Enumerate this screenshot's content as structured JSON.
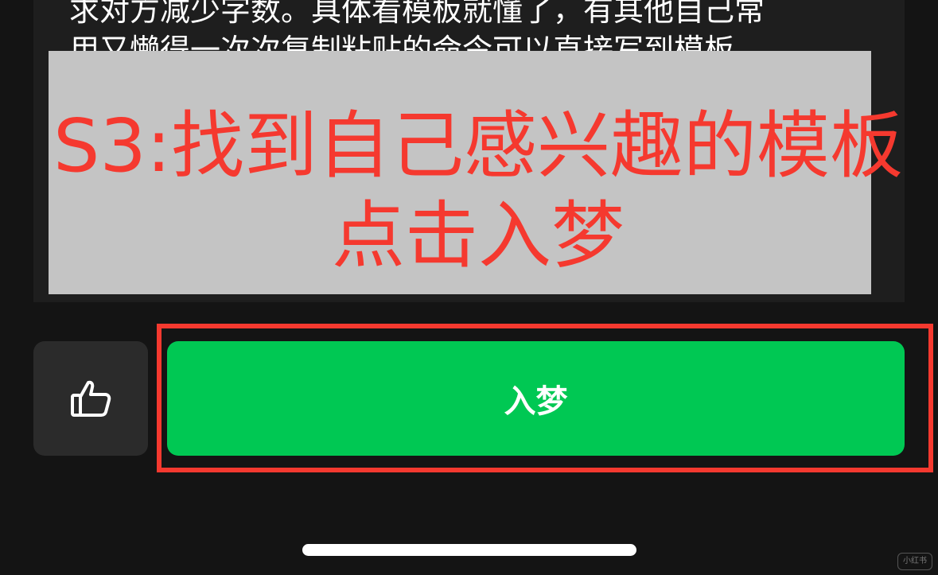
{
  "card": {
    "lines": [
      "求对方减少字数。具体看模板就懂了，有其他自己常",
      "用又懒得一次次复制粘贴的命令可以直接写到模板"
    ]
  },
  "overlay": {
    "line1": "S3:找到自己感兴趣的模板",
    "line2": "点击入梦"
  },
  "buttons": {
    "like_icon": "thumbs-up-icon",
    "enter_label": "入梦"
  },
  "watermark": {
    "text": "小红书"
  },
  "colors": {
    "background": "#141414",
    "card": "#1e1e1e",
    "overlay": "#c4c4c4",
    "annotation_red": "#f5392f",
    "button_green": "#00c853",
    "like_button_bg": "#2b2b2b"
  }
}
